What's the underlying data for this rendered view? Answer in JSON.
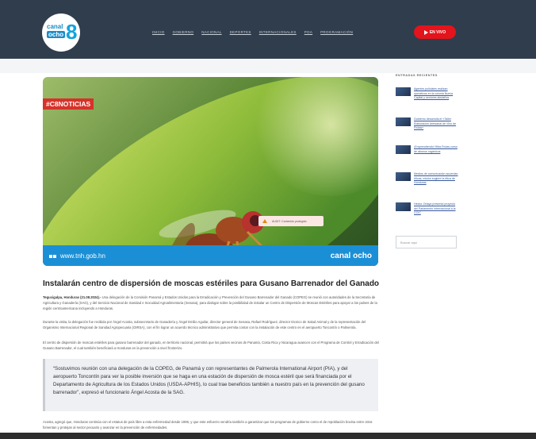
{
  "header": {
    "logo": {
      "line1": "canal",
      "line2": "ocho",
      "digit": "8"
    },
    "nav": [
      "INICIO",
      "GOBIERNO",
      "NACIONAL",
      "DEPORTES",
      "INTERNACIONALES",
      "POA",
      "PROGRAMACIÓN"
    ],
    "live_label": "EN VIVO"
  },
  "hero": {
    "tag": "#C8NOTICIAS",
    "url": "www.tnh.gob.hn",
    "brand": "canal ocho",
    "alert": "AUDIT: Contenido protegido"
  },
  "article": {
    "title": "Instalarán centro de dispersión de moscas estériles para Gusano Barrenador del Ganado",
    "lead_bold": "Tegucigalpa, Honduras (21.08.2024).-",
    "p1": "Una delegación de la Comisión Panamá y Estados Unidos para la Erradicación y Prevención del Gusano Barrenador del Ganado (COPEG) se reunió con autoridades de la Secretaría de Agricultura y Ganadería (SAG), y del Servicio Nacional de Sanidad e Inocuidad Agroalimentaria (Senasa), para dialogar sobre la posibilidad de instalar un Centro de Dispersión de Moscas Estériles para apoyar a los países de la región centroamericana incluyendo a Honduras.",
    "p2": "Durante la visita, la delegación fue recibida por Ángel Acosta, subsecretario de Ganadería y Ángel Emilio Aguilar, director general de Senasa, Rafael Rodríguez, director técnico de Salud Animal y de la representación del Organismo Internacional Regional de Sanidad Agropecuaria (OIRSA), con el fin lograr un acuerdo técnico administrativo que permita contar con la instalación de este centro en el aeropuerto Toncontín o Palmerola.",
    "p3": "El centro de dispersión de moscas estériles para gusano barrenador del ganado, en territorio nacional, permitirá que los países vecinos de Panamá, Costa Rica y Nicaragua avancen con el Programa de Control y Erradicación del Gusano Barrenador, el cual también beneficiará a Honduras en la prevención a nivel fronterizo.",
    "quote": "“Sostuvimos reunión con una delegación de la COPEG, de Panamá y con representantes de Palmerola International Airport (PIA), y del aeropuerto Toncontín para ver la posible inversión que se haga en una estación de dispersión de mosca estéril que será financiada por el Departamento de Agricultura de los Estados Unidos (USDA-APHIS), lo cual trae beneficios también a nuestro país en la prevención del gusano barrenador”, expresó el funcionario Ángel Acosta de la SAG.",
    "p4": "Acosta, agregó que, Honduras continúa con el estatus de país libre a esta enfermedad desde 1996, y que este esfuerzo vendría también a garantizar que los programas de gobierno como el de repoblación bovina entre otros fomentan y protejan al sector pecuario y avanzar en la prevención de enfermedades."
  },
  "sidebar": {
    "title": "ENTRADAS RECIENTES",
    "items": [
      "Agentes policiales realizan operativos en la colonia Nueva Capital y sectores aledaños",
      "Gobierno desarrolla el «Taller Elaboración Artesanal de Vino de Frutas»",
      "¡Emprendiendo! Hiba Frutas curso de abonos orgánicos",
      "Medios de comunicación acuerdan éticas, misión sugiere la ética de Honduras",
      "Héctor Zelaya presenta proyecto del Parlamento Internacional a la CCIC"
    ],
    "search_placeholder": "Buscar aquí"
  }
}
